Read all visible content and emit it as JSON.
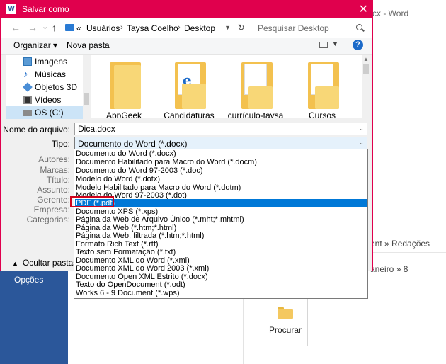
{
  "background": {
    "title_fragment": "cx - Word",
    "opcoes": "Opções",
    "fragments": [
      "ent » Redações",
      "aneiro » 8"
    ],
    "procurar": "Procurar"
  },
  "dialog": {
    "title": "Salvar como",
    "app_icon_letter": "W",
    "close": "✕"
  },
  "nav": {
    "back": "←",
    "forward": "→",
    "dropdown": "⌄",
    "up": "↑",
    "address_prefix": "«",
    "path": [
      "Usuários",
      "Taysa Coelho",
      "Desktop"
    ],
    "refresh": "↻",
    "search_placeholder": "Pesquisar Desktop"
  },
  "toolbar": {
    "organizar": "Organizar ▾",
    "nova_pasta": "Nova pasta",
    "help": "?"
  },
  "sidebar": {
    "items": [
      {
        "label": "Imagens",
        "icon": "images-icon"
      },
      {
        "label": "Músicas",
        "icon": "music-icon"
      },
      {
        "label": "Objetos 3D",
        "icon": "objects-3d-icon"
      },
      {
        "label": "Vídeos",
        "icon": "video-icon"
      },
      {
        "label": "OS (C:)",
        "icon": "drive-icon",
        "selected": true
      }
    ]
  },
  "files": [
    {
      "name": "AppGeek",
      "type": "folder"
    },
    {
      "name": "Candidaturas",
      "type": "folder-edge"
    },
    {
      "name": "currículo-taysa",
      "type": "folder-doc"
    },
    {
      "name": "Cursos",
      "type": "folder-doc"
    }
  ],
  "form": {
    "nome_label": "Nome do arquivo:",
    "nome_value": "Dica.docx",
    "tipo_label": "Tipo:",
    "tipo_value": "Documento do Word (*.docx)",
    "meta_labels": [
      "Autores:",
      "Marcas:",
      "Título:",
      "Assunto:",
      "Gerente:",
      "Empresa:",
      "Categorias:"
    ]
  },
  "ocultar_pastas": "Ocultar pastas",
  "file_types": [
    "Documento do Word (*.docx)",
    "Documento Habilitado para Macro do Word (*.docm)",
    "Documento do Word 97-2003 (*.doc)",
    "Modelo do Word (*.dotx)",
    "Modelo Habilitado para Macro do Word (*.dotm)",
    "Modelo do Word 97-2003 (*.dot)",
    "PDF (*.pdf)",
    "Documento XPS (*.xps)",
    "Página da Web de Arquivo Único (*.mht;*.mhtml)",
    "Página da Web (*.htm;*.html)",
    "Página da Web, filtrada (*.htm;*.html)",
    "Formato Rich Text (*.rtf)",
    "Texto sem Formatação (*.txt)",
    "Documento XML do Word (*.xml)",
    "Documento XML do Word 2003 (*.xml)",
    "Documento Open XML Estrito (*.docx)",
    "Texto do OpenDocument (*.odt)",
    "Works 6 - 9 Document (*.wps)"
  ],
  "selected_type_index": 6,
  "colors": {
    "accent": "#e0004d",
    "selection": "#0078d7",
    "highlight_box": "#d0021b",
    "word_blue": "#2b579a"
  }
}
